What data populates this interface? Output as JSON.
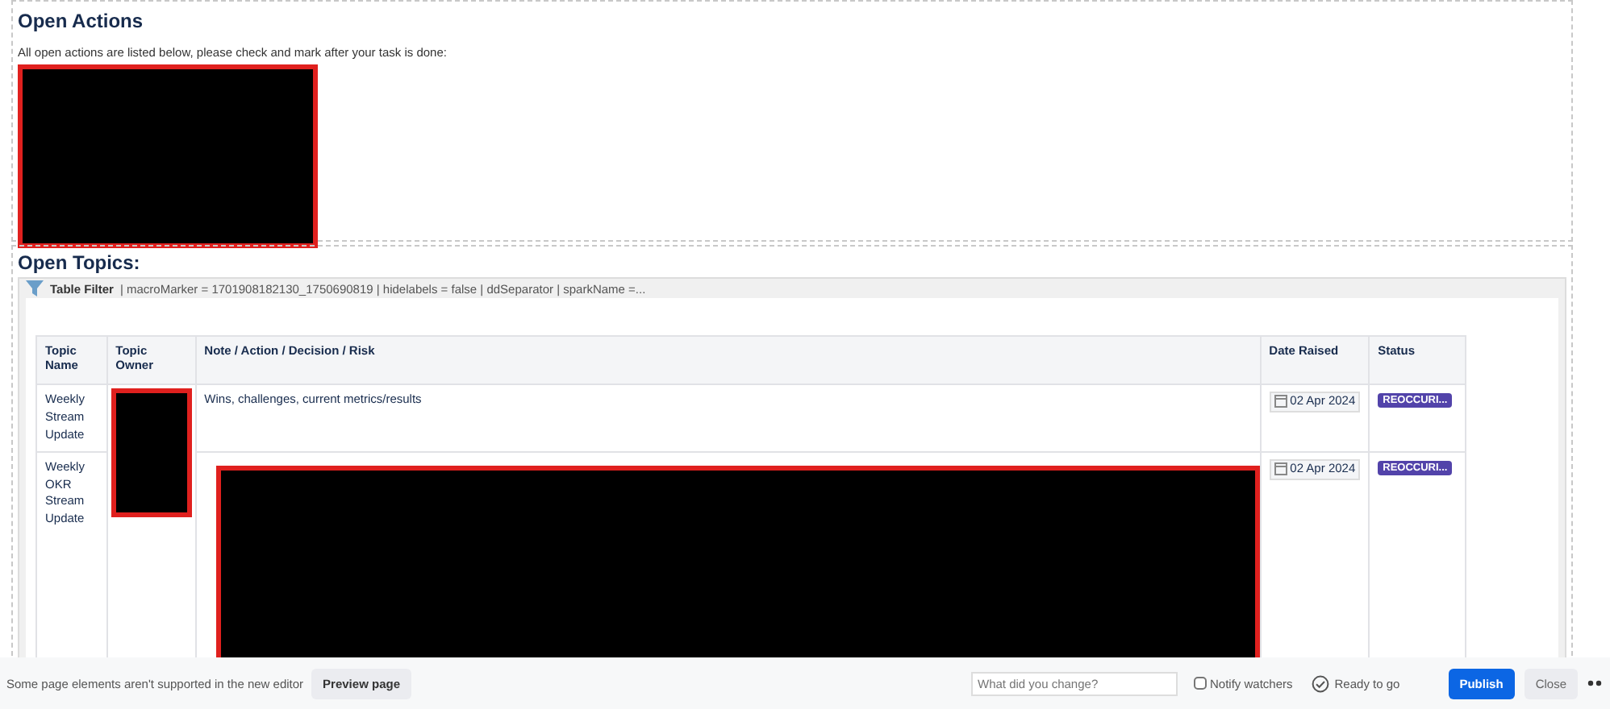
{
  "actions_section": {
    "title": "Open Actions",
    "intro": "All open actions are listed below, please check and mark after your task is done:"
  },
  "topics_section": {
    "title": "Open Topics:",
    "filter_label": "Table Filter",
    "filter_params": "| macroMarker = 1701908182130_1750690819 | hidelabels = false | ddSeparator | sparkName =...",
    "table": {
      "columns": [
        "Topic Name",
        "Topic Owner",
        "Note / Action / Decision / Risk",
        "Date Raised",
        "Status"
      ],
      "rows": [
        {
          "topic": "Weekly Stream Update",
          "note": "Wins, challenges, current metrics/results",
          "date": "02 Apr 2024",
          "status": "REOCCURI...",
          "color": "#5243aa"
        },
        {
          "topic": "Weekly OKR Stream Update",
          "note": "",
          "date": "02 Apr 2024",
          "status": "REOCCURI...",
          "color": "#5243aa"
        }
      ]
    }
  },
  "footer": {
    "notice": "Some page elements aren't supported in the new editor",
    "preview_button": "Preview page",
    "change_field": {
      "placeholder": "What did you change?"
    },
    "notify": {
      "label": "Notify watchers",
      "checked": false
    },
    "ready": "Ready to go",
    "publish_button": "Publish",
    "close_button": "Close"
  }
}
